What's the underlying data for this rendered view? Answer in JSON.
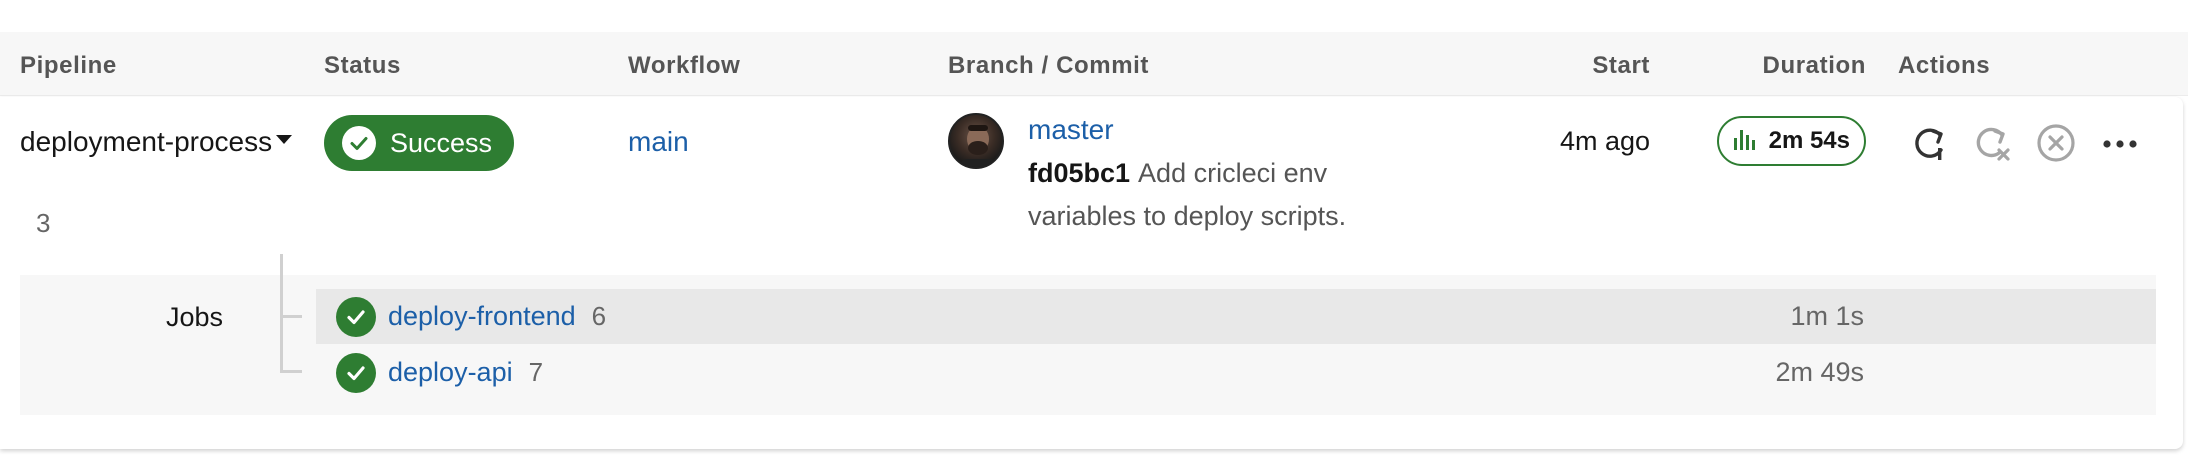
{
  "table": {
    "headers": {
      "pipeline": "Pipeline",
      "status": "Status",
      "workflow": "Workflow",
      "branch_commit": "Branch / Commit",
      "start": "Start",
      "duration": "Duration",
      "actions": "Actions"
    }
  },
  "pipeline": {
    "name": "deployment-process",
    "number": "3",
    "status": "Success",
    "workflow": "main",
    "branch": "master",
    "commit_hash": "fd05bc1",
    "commit_message_line1": "Add cricleci env",
    "commit_message_line2": "variables to deploy scripts.",
    "start": "4m ago",
    "duration": "2m 54s"
  },
  "jobs": {
    "label": "Jobs",
    "items": [
      {
        "name": "deploy-frontend",
        "number": "6",
        "duration": "1m 1s"
      },
      {
        "name": "deploy-api",
        "number": "7",
        "duration": "2m 49s"
      }
    ]
  },
  "icons": {
    "status_check": "check-icon",
    "duration": "bar-chart-icon",
    "rerun": "rerun-icon",
    "rerun_failed": "rerun-failed-icon",
    "cancel": "cancel-icon",
    "more": "more-icon"
  },
  "colors": {
    "success": "#2e7d32",
    "link": "#1c5fa8",
    "disabled_icon": "#a5a5a5"
  }
}
